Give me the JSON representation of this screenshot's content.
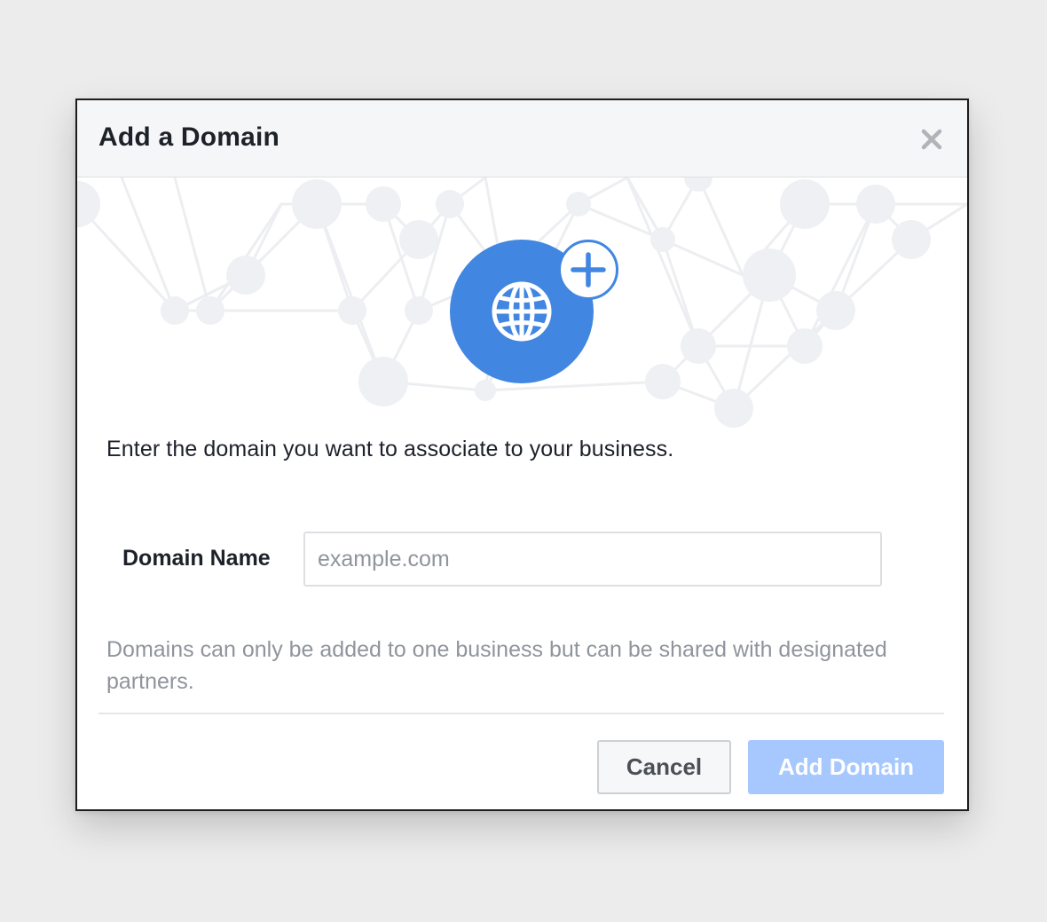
{
  "dialog": {
    "title": "Add a Domain",
    "close_icon": "close-icon",
    "hero_icon": "globe-icon",
    "badge_icon": "plus-icon",
    "intro_text": "Enter the domain you want to associate to your business.",
    "field": {
      "label": "Domain Name",
      "placeholder": "example.com",
      "value": ""
    },
    "note": "Domains can only be added to one business but can be shared with designated partners.",
    "buttons": {
      "cancel_label": "Cancel",
      "add_label": "Add Domain"
    }
  },
  "colors": {
    "accent": "#4186e0",
    "disabled_primary": "#a6c8ff",
    "header_bg": "#f5f6f7",
    "page_bg": "#ececec",
    "muted_text": "#90949c"
  }
}
